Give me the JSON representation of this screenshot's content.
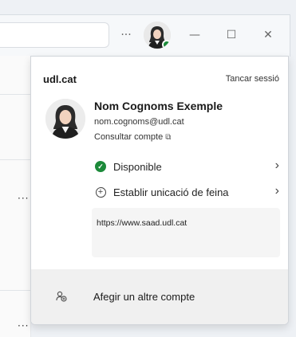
{
  "titlebar": {
    "more_label": "···",
    "minimize_label": "—",
    "maximize_label": "☐",
    "close_label": "✕"
  },
  "background": {
    "more_label": "···"
  },
  "account": {
    "org": "udl.cat",
    "signout_label": "Tancar sessió",
    "name": "Nom Cognoms Exemple",
    "email": "nom.cognoms@udl.cat",
    "view_account_label": "Consultar compte",
    "external_icon": "external-link-icon",
    "status_label": "Disponible",
    "status_color": "#1c8a3a",
    "location_label": "Establir unicació de feina",
    "status_message": "https://www.saad.udl.cat"
  },
  "footer": {
    "add_account_label": "Afegir un altre compte"
  },
  "colors": {
    "popup_bg": "#ffffff",
    "footer_bg": "#f0f0f0",
    "note_bg": "#f5f5f5"
  }
}
